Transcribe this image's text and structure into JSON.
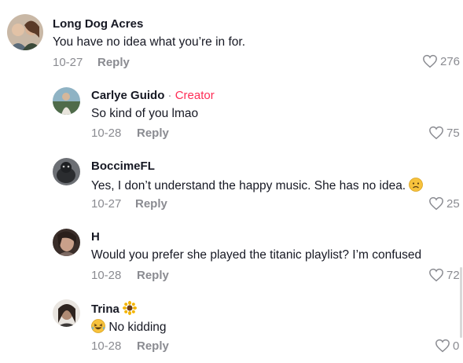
{
  "comments": [
    {
      "username": "Long Dog Acres",
      "text": "You have no idea what you’re in for.",
      "date": "10-27",
      "reply_label": "Reply",
      "likes": "276"
    },
    {
      "username": "Carlye Guido",
      "badge_separator": " · ",
      "badge": "Creator",
      "text": "So kind of you lmao",
      "date": "10-28",
      "reply_label": "Reply",
      "likes": "75"
    },
    {
      "username": "BoccimeFL",
      "text": "Yes, I don’t understand the happy music. She has no idea.",
      "emoji": "sad-face-emoji",
      "date": "10-27",
      "reply_label": "Reply",
      "likes": "25"
    },
    {
      "username": "H",
      "text": "Would you prefer she played the titanic playlist? I’m confused",
      "date": "10-28",
      "reply_label": "Reply",
      "likes": "72"
    },
    {
      "username": "Trina",
      "name_emoji": "sunflower-emoji",
      "text_emoji": "laughing-face-emoji",
      "text": "No kidding",
      "date": "10-28",
      "reply_label": "Reply",
      "likes": "0"
    }
  ],
  "colors": {
    "text": "#161823",
    "secondary": "#8a8b91",
    "creator": "#fe2c55"
  }
}
